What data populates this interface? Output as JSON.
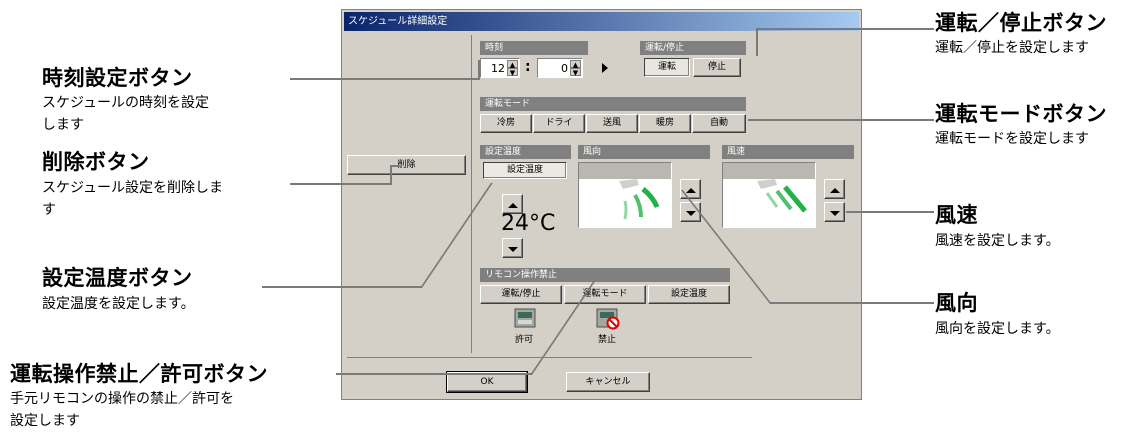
{
  "annotations": {
    "time_button": {
      "title": "時刻設定ボタン",
      "desc": [
        "スケジュールの時刻を設定",
        "します"
      ]
    },
    "delete_button": {
      "title": "削除ボタン",
      "desc": [
        "スケジュール設定を削除しま",
        "す"
      ]
    },
    "settemp_button": {
      "title": "設定温度ボタン",
      "desc": [
        "設定温度を設定します。"
      ]
    },
    "lock_button": {
      "title": "運転操作禁止／許可ボタン",
      "desc": [
        "手元リモコンの操作の禁止／許可を",
        "設定します"
      ]
    },
    "runstop_button": {
      "title": "運転／停止ボタン",
      "desc": [
        "運転／停止を設定します"
      ]
    },
    "mode_button": {
      "title": "運転モードボタン",
      "desc": [
        "運転モードを設定します"
      ]
    },
    "fan_speed": {
      "title": "風速",
      "desc": [
        "風速を設定します。"
      ]
    },
    "fan_direction": {
      "title": "風向",
      "desc": [
        "風向を設定します。"
      ]
    }
  },
  "dialog": {
    "title": "スケジュール詳細設定",
    "delete_label": "削除",
    "time": {
      "header": "時刻",
      "hour": "12",
      "minute": "0",
      "colon": ":"
    },
    "runstop": {
      "header": "運転/停止",
      "run": "運転",
      "stop": "停止"
    },
    "mode": {
      "header": "運転モード",
      "options": [
        "冷房",
        "ドライ",
        "送風",
        "暖房",
        "自動"
      ]
    },
    "settemp": {
      "header": "設定温度",
      "button": "設定温度",
      "value": "24°C"
    },
    "direction": {
      "header": "風向"
    },
    "speed": {
      "header": "風速"
    },
    "lock": {
      "header": "リモコン操作禁止",
      "buttons": [
        "運転/停止",
        "運転モード",
        "設定温度"
      ],
      "allow_label": "許可",
      "prohibit_label": "禁止"
    },
    "ok_label": "OK",
    "cancel_label": "キャンセル"
  },
  "colors": {
    "titlebar_start": "#0a246a",
    "titlebar_end": "#a6caf0",
    "dialog_face": "#d4d0c8",
    "fan_green": "#22b04a",
    "prohibit_red": "#e00000"
  }
}
